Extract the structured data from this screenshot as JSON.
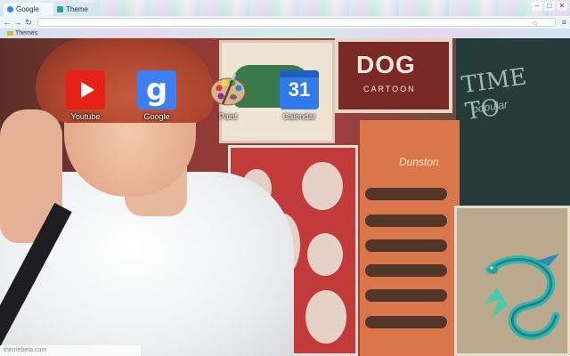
{
  "browser": {
    "tabs": [
      {
        "label": "Google",
        "active": true
      },
      {
        "label": "Theme",
        "active": false
      }
    ],
    "window_controls": {
      "minimize": "–",
      "maximize": "□",
      "close": "✕"
    },
    "nav": {
      "back": "←",
      "forward": "→",
      "reload": "↻"
    },
    "omnibox": {
      "value": ""
    },
    "bookmarks": [
      {
        "label": "Themes"
      }
    ]
  },
  "shortcuts": [
    {
      "label": "Youtube",
      "icon": "youtube-icon"
    },
    {
      "label": "Google",
      "icon": "google-icon",
      "glyph": "g"
    },
    {
      "label": "Paint",
      "icon": "paint-palette-icon"
    },
    {
      "label": "Calendar",
      "icon": "calendar-icon",
      "glyph": "31"
    }
  ],
  "background": {
    "poster_title": "DOG",
    "poster_subtitle": "CARTOON",
    "sign_text": "TIME TO",
    "sign_subtext": "popular",
    "orange_text": "Dunston"
  },
  "footer": {
    "text": "themebeta.com"
  },
  "colors": {
    "youtube_red": "#e62117",
    "google_blue": "#3d7ff2",
    "calendar_blue": "#2f7be8",
    "tie": "#1d1d22",
    "hair": "#a8432c",
    "dragon_teal": "#2fb7a8"
  }
}
